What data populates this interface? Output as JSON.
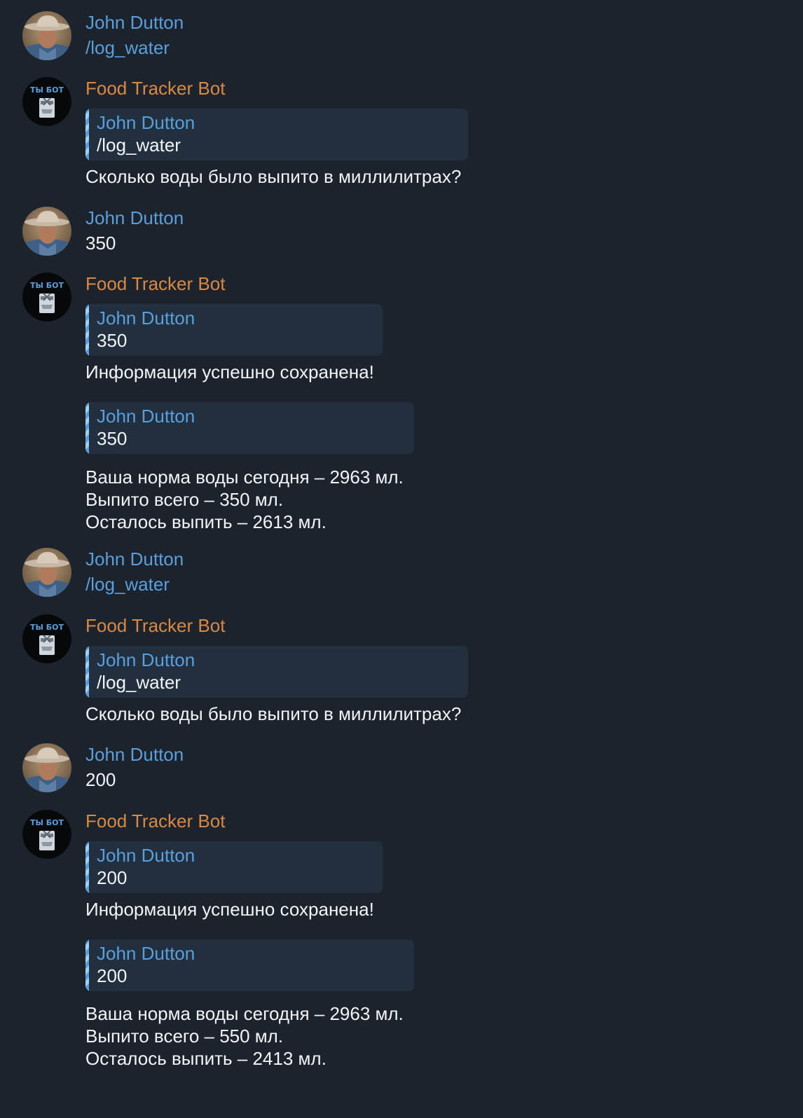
{
  "user": {
    "name": "John Dutton",
    "avatar_icon": "user-photo-icon"
  },
  "bot": {
    "name": "Food Tracker Bot",
    "avatar_icon": "bot-avatar-icon",
    "avatar_caption": "ТЫ БОТ"
  },
  "colors": {
    "background": "#1c232d",
    "user_name": "#5a9fdc",
    "bot_name": "#d98943",
    "quote_bg": "#222f3f",
    "text": "#f2f4f7"
  },
  "messages": [
    {
      "sender": "John Dutton",
      "text": "/log_water"
    },
    {
      "sender": "Food Tracker Bot",
      "quote": {
        "name": "John Dutton",
        "text": "/log_water"
      },
      "text": "Сколько воды было выпито в миллилитрах?"
    },
    {
      "sender": "John Dutton",
      "text": "350"
    },
    {
      "sender": "Food Tracker Bot",
      "quote": {
        "name": "John Dutton",
        "text": "350"
      },
      "text": "Информация успешно сохранена!"
    },
    {
      "quote": {
        "name": "John Dutton",
        "text": "350"
      },
      "lines": [
        "Ваша норма воды сегодня – 2963 мл.",
        "Выпито всего – 350 мл.",
        "Осталось выпить – 2613 мл."
      ]
    },
    {
      "sender": "John Dutton",
      "text": "/log_water"
    },
    {
      "sender": "Food Tracker Bot",
      "quote": {
        "name": "John Dutton",
        "text": "/log_water"
      },
      "text": "Сколько воды было выпито в миллилитрах?"
    },
    {
      "sender": "John Dutton",
      "text": "200"
    },
    {
      "sender": "Food Tracker Bot",
      "quote": {
        "name": "John Dutton",
        "text": "200"
      },
      "text": "Информация успешно сохранена!"
    },
    {
      "quote": {
        "name": "John Dutton",
        "text": "200"
      },
      "lines": [
        "Ваша норма воды сегодня – 2963 мл.",
        "Выпито всего – 550 мл.",
        "Осталось выпить – 2413 мл."
      ]
    }
  ]
}
